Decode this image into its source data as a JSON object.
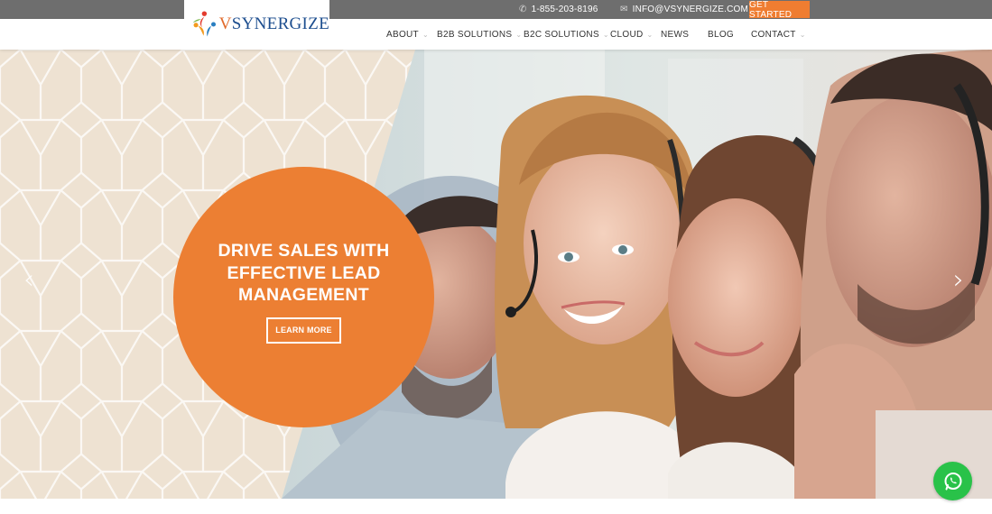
{
  "topbar": {
    "phone": "1-855-203-8196",
    "email": "INFO@VSYNERGIZE.COM",
    "cta": "GET STARTED",
    "phone_icon": "phone-icon",
    "email_icon": "mail-icon"
  },
  "brand": {
    "prefix": "V",
    "name": "SYNERGIZE",
    "logo_icon": "people-swirl-logo-icon"
  },
  "nav": {
    "items": [
      {
        "label": "ABOUT",
        "has_dropdown": true
      },
      {
        "label": "B2B SOLUTIONS",
        "has_dropdown": true
      },
      {
        "label": "B2C SOLUTIONS",
        "has_dropdown": true
      },
      {
        "label": "CLOUD",
        "has_dropdown": true
      },
      {
        "label": "NEWS",
        "has_dropdown": false
      },
      {
        "label": "BLOG",
        "has_dropdown": false
      },
      {
        "label": "CONTACT",
        "has_dropdown": true
      }
    ]
  },
  "hero": {
    "headline": "DRIVE SALES WITH EFFECTIVE LEAD MANAGEMENT",
    "button_label": "LEARN MORE",
    "prev_icon": "chevron-left-icon",
    "next_icon": "chevron-right-icon"
  },
  "floating": {
    "chat_icon": "whatsapp-icon"
  },
  "colors": {
    "accent": "#ec7f33",
    "topbar": "#6e6e6e",
    "brand_blue": "#1d4e8f",
    "pattern_bg": "#eee2d2",
    "whatsapp": "#29c249"
  }
}
